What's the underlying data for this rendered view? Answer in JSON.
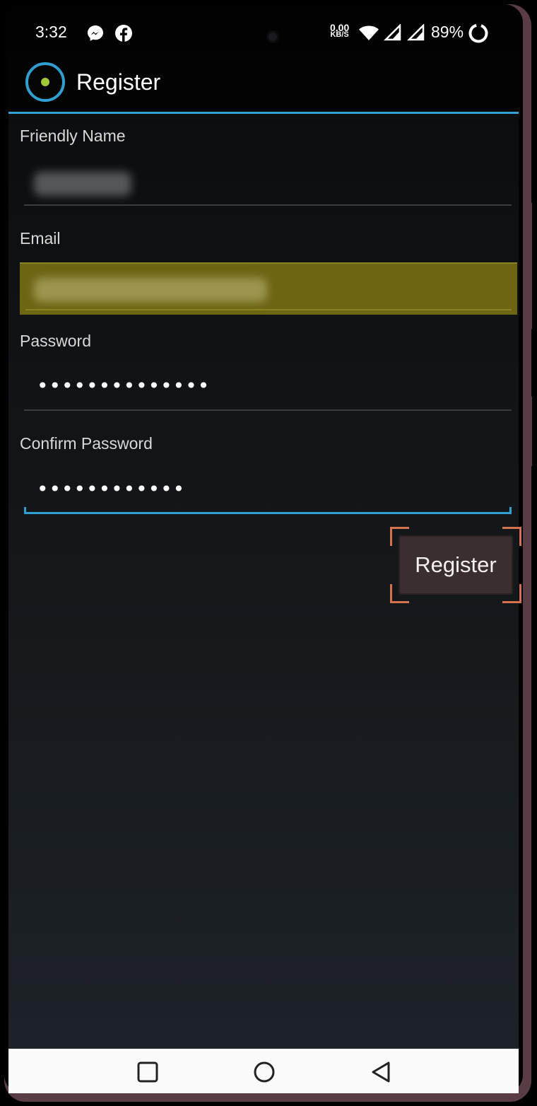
{
  "status_bar": {
    "time": "3:32",
    "notification_icons": [
      "messenger-icon",
      "facebook-icon"
    ],
    "network_speed_value": "0.00",
    "network_speed_unit": "KB/S",
    "battery_percent": "89%"
  },
  "app_bar": {
    "title": "Register",
    "icon": "android-app-icon",
    "accent_color": "#34a2d4"
  },
  "form": {
    "friendly_name_label": "Friendly Name",
    "email_label": "Email",
    "password_label": "Password",
    "password_value": "••••••••••••••",
    "confirm_password_label": "Confirm Password",
    "confirm_password_value": "••••••••••••",
    "email_highlight_color": "#6c6514"
  },
  "actions": {
    "register_label": "Register",
    "highlight_color": "#d6714f"
  },
  "nav_bar": {
    "icons": [
      "recents-icon",
      "home-icon",
      "back-icon"
    ]
  }
}
